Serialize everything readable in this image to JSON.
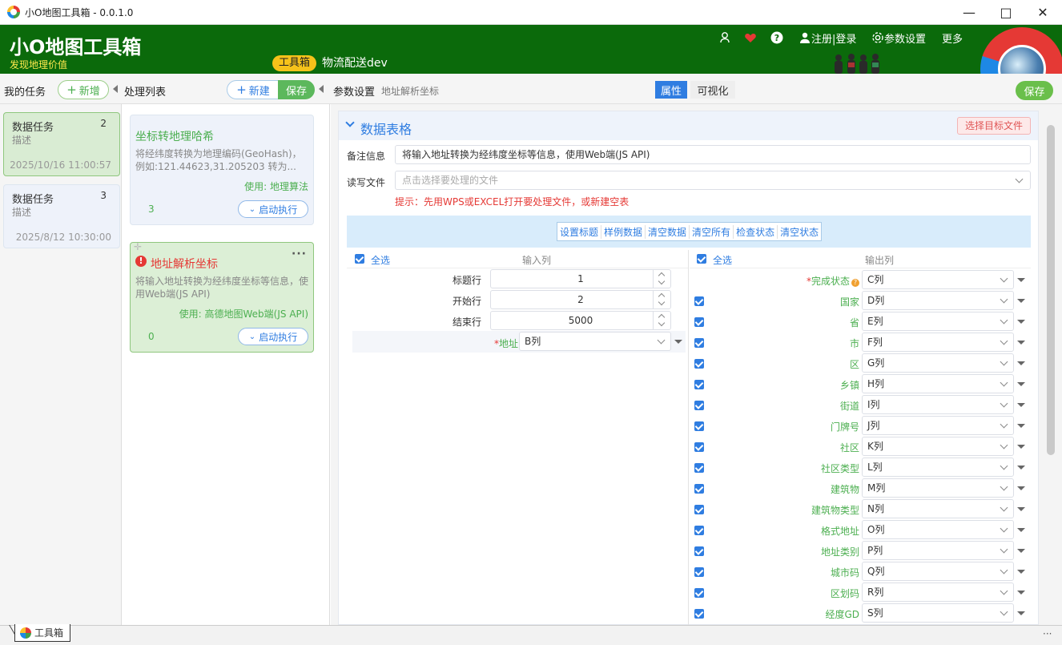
{
  "window": {
    "title": "小O地图工具箱 - 0.0.1.0"
  },
  "header": {
    "brand": "小O地图工具箱",
    "slogan": "发现地理价值",
    "tool_tag": "工具箱",
    "project": "物流配送dev",
    "register_login": "注册|登录",
    "settings": "参数设置",
    "more": "更多"
  },
  "tasks_panel": {
    "title": "我的任务",
    "add_label": "新增",
    "items": [
      {
        "title": "数据任务",
        "desc": "描述",
        "count": "2",
        "date": "2025/10/16 11:00:57"
      },
      {
        "title": "数据任务",
        "desc": "描述",
        "count": "3",
        "date": "2025/8/12 10:30:00"
      }
    ]
  },
  "process_panel": {
    "title": "处理列表",
    "new_label": "新建",
    "save_label": "保存",
    "cards": [
      {
        "title": "坐标转地理哈希",
        "desc": "将经纬度转换为地理编码(GeoHash)，例如:121.44623,31.205203 转为...",
        "use": "使用: 地理算法",
        "count": "3",
        "run": "启动执行"
      },
      {
        "title": "地址解析坐标",
        "desc": "将输入地址转换为经纬度坐标等信息，使用Web端(JS API)",
        "use": "使用: 高德地图Web端(JS API)",
        "count": "0",
        "run": "启动执行"
      }
    ]
  },
  "params_panel": {
    "title": "参数设置",
    "subtitle": "地址解析坐标",
    "tab_attr": "属性",
    "tab_visual": "可视化",
    "save_label": "保存"
  },
  "section": {
    "title": "数据表格",
    "select_target": "选择目标文件",
    "remark_label": "备注信息",
    "remark_value": "将输入地址转换为经纬度坐标等信息，使用Web端(JS API)",
    "file_label": "读写文件",
    "file_placeholder": "点击选择要处理的文件",
    "hint": "提示：先用WPS或EXCEL打开要处理文件，或新建空表",
    "toolbar": [
      "设置标题",
      "样例数据",
      "清空数据",
      "清空所有",
      "检查状态",
      "清空状态"
    ],
    "select_all": "全选",
    "input_header": "输入列",
    "output_header": "输出列",
    "title_row_label": "标题行",
    "title_row": "1",
    "start_row_label": "开始行",
    "start_row": "2",
    "end_row_label": "结束行",
    "end_row": "5000",
    "address_label": "地址",
    "address_col": "B列",
    "status_label": "完成状态",
    "status_col": "C列",
    "outputs": [
      {
        "label": "国家",
        "col": "D列"
      },
      {
        "label": "省",
        "col": "E列"
      },
      {
        "label": "市",
        "col": "F列"
      },
      {
        "label": "区",
        "col": "G列"
      },
      {
        "label": "乡镇",
        "col": "H列"
      },
      {
        "label": "街道",
        "col": "I列"
      },
      {
        "label": "门牌号",
        "col": "J列"
      },
      {
        "label": "社区",
        "col": "K列"
      },
      {
        "label": "社区类型",
        "col": "L列"
      },
      {
        "label": "建筑物",
        "col": "M列"
      },
      {
        "label": "建筑物类型",
        "col": "N列"
      },
      {
        "label": "格式地址",
        "col": "O列"
      },
      {
        "label": "地址类别",
        "col": "P列"
      },
      {
        "label": "城市码",
        "col": "Q列"
      },
      {
        "label": "区划码",
        "col": "R列"
      },
      {
        "label": "经度GD",
        "col": "S列"
      }
    ]
  },
  "statusbar": {
    "tab": "工具箱"
  },
  "colors": {
    "header": "#0b6a0b",
    "accent": "#4caf50",
    "link": "#2f7de1",
    "warn": "#e53935"
  }
}
